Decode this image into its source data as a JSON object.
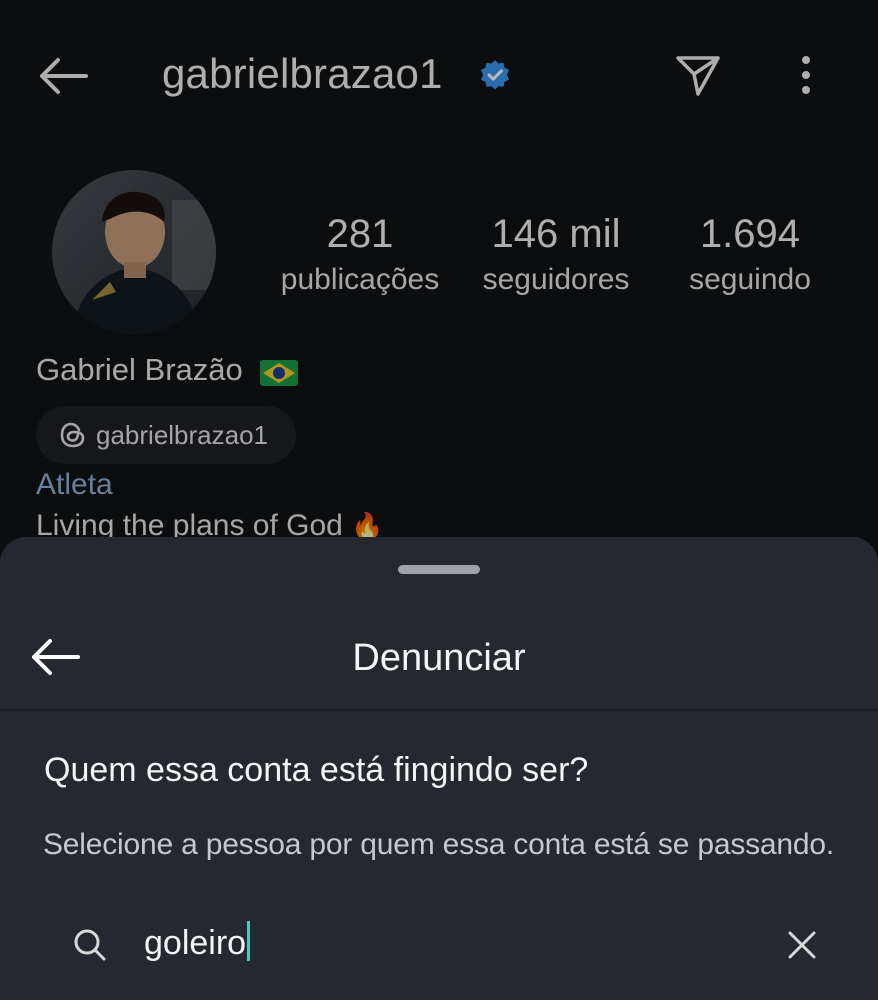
{
  "profile": {
    "username": "gabrielbrazao1",
    "stats": [
      {
        "value": "281",
        "label": "publicações"
      },
      {
        "value": "146 mil",
        "label": "seguidores"
      },
      {
        "value": "1.694",
        "label": "seguindo"
      }
    ],
    "full_name": "Gabriel Brazão",
    "threads_handle": "gabrielbrazao1",
    "category": "Atleta",
    "bio": "Living the plans of God",
    "bio_emoji": "🔥"
  },
  "sheet": {
    "title": "Denunciar",
    "question": "Quem essa conta está fingindo ser?",
    "subtitle": "Selecione a pessoa por quem essa conta está se passando.",
    "search": {
      "value": "goleiro"
    }
  },
  "colors": {
    "background": "#0c0d0f",
    "sheet": "#25292f",
    "verified": "#3797f0",
    "category": "#8fb1d9",
    "caret": "#4ec6c6"
  },
  "icons": [
    "back-arrow-icon",
    "verified-badge-icon",
    "send-icon",
    "more-vertical-icon",
    "threads-icon",
    "brazil-flag-icon",
    "search-icon",
    "close-icon"
  ]
}
